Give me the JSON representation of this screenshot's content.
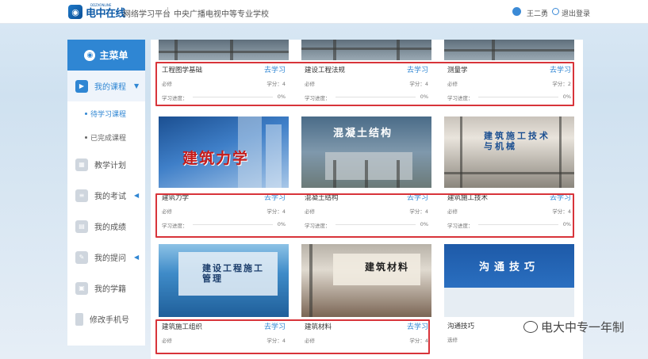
{
  "header": {
    "logo_text": "电中在线",
    "logo_sub": "DDZXONLINE",
    "platform": "网络学习平台",
    "school": "中央广播电视中等专业学校",
    "username": "王二勇",
    "logout": "退出登录"
  },
  "sidebar": {
    "title": "主菜单",
    "items": [
      {
        "label": "我的课程",
        "active": true,
        "icon": "play-icon"
      },
      {
        "label": "教学计划",
        "icon": "calendar-icon"
      },
      {
        "label": "我的考试",
        "icon": "exam-icon"
      },
      {
        "label": "我的成绩",
        "icon": "score-icon"
      },
      {
        "label": "我的提问",
        "icon": "question-icon"
      },
      {
        "label": "我的学籍",
        "icon": "profile-icon"
      },
      {
        "label": "修改手机号",
        "icon": "phone-icon"
      }
    ],
    "sub_items": [
      {
        "label": "待学习课程",
        "active": true
      },
      {
        "label": "已完成课程"
      }
    ]
  },
  "labels": {
    "go_learn": "去学习",
    "credit_prefix": "学分：",
    "progress": "学习进度：",
    "required": "必修",
    "elective": "选修"
  },
  "courses": [
    {
      "name": "工程图学基础",
      "type": "必修",
      "credit": "4",
      "progress": "0%"
    },
    {
      "name": "建设工程法规",
      "type": "必修",
      "credit": "4",
      "progress": "0%"
    },
    {
      "name": "测量学",
      "type": "必修",
      "credit": "2",
      "progress": "0%"
    },
    {
      "name": "建筑力学",
      "type": "必修",
      "credit": "4",
      "progress": "0%",
      "thumb_text": "建筑力学"
    },
    {
      "name": "混凝土结构",
      "type": "必修",
      "credit": "4",
      "progress": "0%",
      "thumb_text": "混凝土结构"
    },
    {
      "name": "建筑施工技术",
      "type": "必修",
      "credit": "4",
      "progress": "0%",
      "thumb_text": "建筑施工技术与机械"
    },
    {
      "name": "建筑施工组织",
      "type": "必修",
      "credit": "4",
      "thumb_text": "建设工程施工管理"
    },
    {
      "name": "建筑材料",
      "type": "必修",
      "credit": "4",
      "thumb_text": "建筑材料"
    },
    {
      "name": "沟通技巧",
      "type": "选修",
      "thumb_text": "沟通技巧"
    }
  ],
  "watermark": "电大中专一年制",
  "colors": {
    "accent": "#2f86d3",
    "highlight": "#d8343a"
  }
}
